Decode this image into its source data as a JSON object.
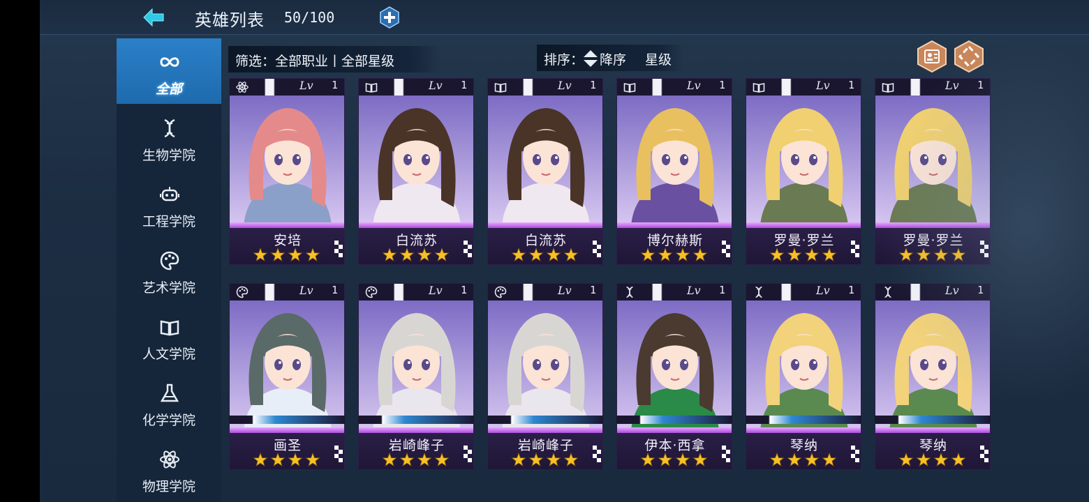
{
  "header": {
    "title": "英雄列表",
    "count": "50/100"
  },
  "sidebar": {
    "items": [
      {
        "label": "全部",
        "icon": "infinity-icon",
        "active": true
      },
      {
        "label": "生物学院",
        "icon": "dna-icon",
        "active": false
      },
      {
        "label": "工程学院",
        "icon": "robot-icon",
        "active": false
      },
      {
        "label": "艺术学院",
        "icon": "palette-icon",
        "active": false
      },
      {
        "label": "人文学院",
        "icon": "book-icon",
        "active": false
      },
      {
        "label": "化学学院",
        "icon": "flask-icon",
        "active": false
      },
      {
        "label": "物理学院",
        "icon": "atom-icon",
        "active": false
      }
    ]
  },
  "filter": {
    "label": "筛选：全部职业丨全部星级"
  },
  "sort": {
    "label": "排序：",
    "order": "降序",
    "key": "星级"
  },
  "heroes": [
    {
      "name": "安培",
      "level": "1",
      "stars": 4,
      "class_icon": "atom-icon",
      "level_prefix": "Lv"
    },
    {
      "name": "白流苏",
      "level": "1",
      "stars": 4,
      "class_icon": "book-icon",
      "level_prefix": "Lv"
    },
    {
      "name": "白流苏",
      "level": "1",
      "stars": 4,
      "class_icon": "book-icon",
      "level_prefix": "Lv"
    },
    {
      "name": "博尔赫斯",
      "level": "1",
      "stars": 4,
      "class_icon": "book-icon",
      "level_prefix": "Lv"
    },
    {
      "name": "罗曼·罗兰",
      "level": "1",
      "stars": 4,
      "class_icon": "book-icon",
      "level_prefix": "Lv"
    },
    {
      "name": "罗曼·罗兰",
      "level": "1",
      "stars": 4,
      "class_icon": "book-icon",
      "level_prefix": "Lv"
    },
    {
      "name": "画圣",
      "level": "1",
      "stars": 4,
      "class_icon": "palette-icon",
      "level_prefix": "Lv"
    },
    {
      "name": "岩崎峰子",
      "level": "1",
      "stars": 4,
      "class_icon": "palette-icon",
      "level_prefix": "Lv"
    },
    {
      "name": "岩崎峰子",
      "level": "1",
      "stars": 4,
      "class_icon": "palette-icon",
      "level_prefix": "Lv"
    },
    {
      "name": "伊本·西拿",
      "level": "1",
      "stars": 4,
      "class_icon": "dna-icon",
      "level_prefix": "Lv"
    },
    {
      "name": "琴纳",
      "level": "1",
      "stars": 4,
      "class_icon": "dna-icon",
      "level_prefix": "Lv"
    },
    {
      "name": "琴纳",
      "level": "1",
      "stars": 4,
      "class_icon": "dna-icon",
      "level_prefix": "Lv"
    }
  ],
  "colors": {
    "accent_blue": "#2b80c8",
    "arrow_cyan": "#2ec8e8",
    "star_gold": "#f5c126",
    "card_purple": "#a58bd9"
  }
}
